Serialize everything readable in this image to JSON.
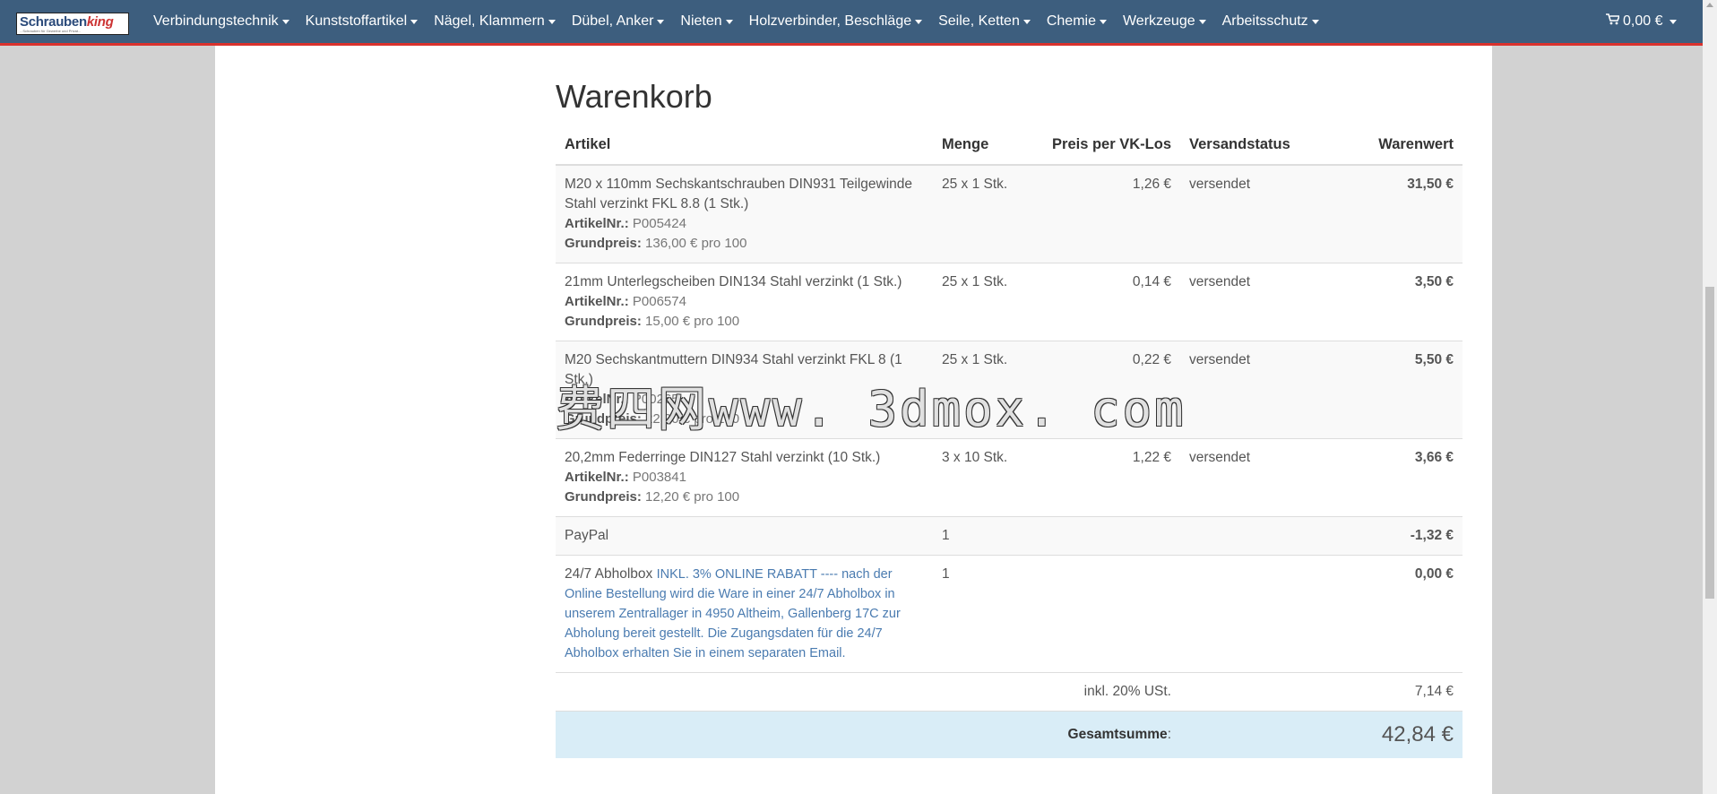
{
  "navbar": {
    "logo": {
      "text_a": "Schrauben",
      "text_b": "king",
      "subtitle": "...Schrauben für Gewerbe und Privat..."
    },
    "items": [
      {
        "label": "Verbindungstechnik"
      },
      {
        "label": "Kunststoffartikel"
      },
      {
        "label": "Nägel, Klammern"
      },
      {
        "label": "Dübel, Anker"
      },
      {
        "label": "Nieten"
      },
      {
        "label": "Holzverbinder, Beschläge"
      },
      {
        "label": "Seile, Ketten"
      },
      {
        "label": "Chemie"
      },
      {
        "label": "Werkzeuge"
      },
      {
        "label": "Arbeitsschutz"
      }
    ],
    "cart_total": "0,00 €",
    "accent_color": "#3d5e7e",
    "border_color": "#d9322d"
  },
  "page": {
    "heading": "Warenkorb"
  },
  "table": {
    "headers": {
      "artikel": "Artikel",
      "menge": "Menge",
      "preis": "Preis per VK-Los",
      "status": "Versandstatus",
      "wert": "Warenwert"
    },
    "labels": {
      "artikelnr": "ArtikelNr.:",
      "grundpreis": "Grundpreis:"
    },
    "rows": [
      {
        "name": "M20 x 110mm Sechskantschrauben DIN931 Teilgewinde Stahl verzinkt FKL 8.8 (1 Stk.)",
        "artikelnr": "P005424",
        "grundpreis": "136,00 € pro 100",
        "menge": "25 x 1 Stk.",
        "preis": "1,26 €",
        "status": "versendet",
        "wert": "31,50 €"
      },
      {
        "name": "21mm Unterlegscheiben DIN134 Stahl verzinkt (1 Stk.)",
        "artikelnr": "P006574",
        "grundpreis": "15,00 € pro 100",
        "menge": "25 x 1 Stk.",
        "preis": "0,14 €",
        "status": "versendet",
        "wert": "3,50 €"
      },
      {
        "name": "M20 Sechskantmuttern DIN934 Stahl verzinkt FKL 8 (1 Stk.)",
        "artikelnr": "P00265",
        "grundpreis": "22,00 € pro 100",
        "menge": "25 x 1 Stk.",
        "preis": "0,22 €",
        "status": "versendet",
        "wert": "5,50 €"
      },
      {
        "name": "20,2mm Federringe DIN127 Stahl verzinkt (10 Stk.)",
        "artikelnr": "P003841",
        "grundpreis": "12,20 € pro 100",
        "menge": "3 x 10 Stk.",
        "preis": "1,22 €",
        "status": "versendet",
        "wert": "3,66 €"
      }
    ],
    "paypal": {
      "name": "PayPal",
      "menge": "1",
      "wert": "-1,32 €"
    },
    "abholbox": {
      "name": "24/7 Abholbox",
      "desc": "INKL. 3% ONLINE RABATT ---- nach der Online Bestellung wird die Ware in einer 24/7 Abholbox in unserem Zentrallager in 4950 Altheim, Gallenberg 17C zur Abholung bereit gestellt. Die Zugangsdaten für die 24/7 Abholbox erhalten Sie in einem separaten Email.",
      "menge": "1",
      "wert": "0,00 €"
    },
    "tax": {
      "label": "inkl. 20% USt.",
      "value": "7,14 €"
    },
    "total": {
      "label": "Gesamtsumme",
      "colon": ":",
      "value": "42,84 €"
    }
  },
  "watermark": {
    "text": "费四网www. 3dmox. com"
  }
}
